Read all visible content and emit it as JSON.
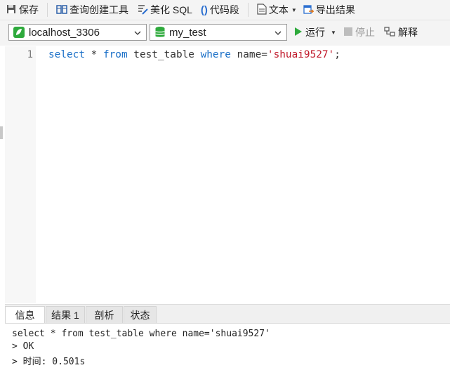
{
  "toolbar": {
    "save": "保存",
    "query_builder": "查询创建工具",
    "beautify_sql": "美化 SQL",
    "snippet": "代码段",
    "text": "文本",
    "export": "导出结果"
  },
  "connection": {
    "server": "localhost_3306",
    "database": "my_test",
    "run": "运行",
    "stop": "停止",
    "explain": "解释"
  },
  "editor": {
    "line_number": "1",
    "tokens": {
      "select": "select",
      "star": " * ",
      "from": "from",
      "table": " test_table ",
      "where": "where",
      "eq": " name=",
      "value": "'shuai9527'",
      "semi": ";"
    }
  },
  "bottom": {
    "tabs": [
      "信息",
      "结果 1",
      "剖析",
      "状态"
    ],
    "output": [
      "select * from test_table where name='shuai9527'",
      "> OK",
      "> 时间: 0.501s"
    ]
  },
  "colors": {
    "keyword": "#1a6fc7",
    "string": "#c0182a",
    "run_green": "#2eaa3c",
    "db_green": "#2eaa3c"
  }
}
